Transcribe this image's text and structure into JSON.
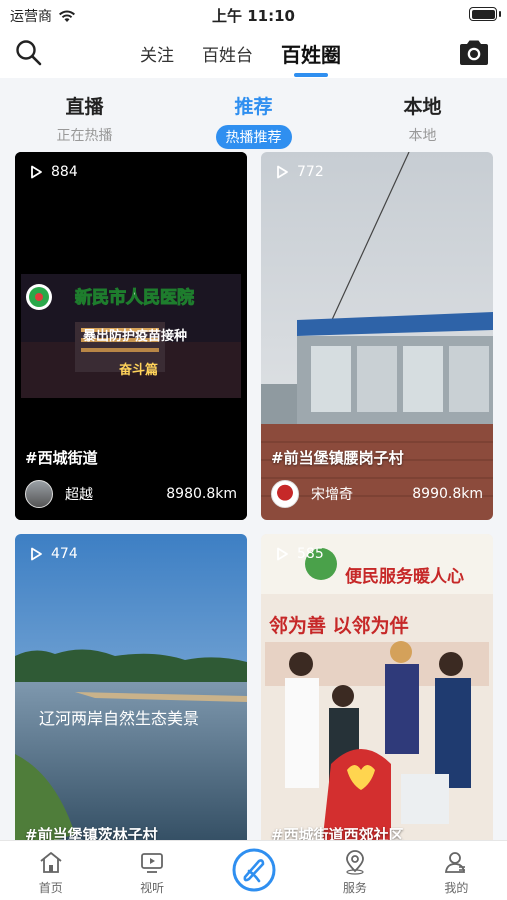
{
  "status_bar": {
    "carrier": "运营商",
    "time": "上午 11:10"
  },
  "top_nav": {
    "tabs": [
      {
        "label": "关注"
      },
      {
        "label": "百姓台"
      },
      {
        "label": "百姓圈",
        "active": true
      }
    ],
    "icons": {
      "search": "search-icon",
      "camera": "camera-icon"
    }
  },
  "sub_tabs": [
    {
      "title": "直播",
      "desc": "正在热播"
    },
    {
      "title": "推荐",
      "desc": "热播推荐",
      "active": true
    },
    {
      "title": "本地",
      "desc": "本地"
    }
  ],
  "cards": [
    {
      "plays": "884",
      "title": "#西城街道",
      "author": "超越",
      "distance": "8980.8km"
    },
    {
      "plays": "772",
      "title": "#前当堡镇腰岗子村",
      "author": "宋增奇",
      "distance": "8990.8km"
    },
    {
      "plays": "474",
      "title": "#前当堡镇茨林子村",
      "overlay_text": "辽河两岸自然生态美景"
    },
    {
      "plays": "585",
      "title": "#西城街道西郊社区",
      "sign_top": "便民服务暖人心",
      "sign_mid": "邻为善  以邻为伴"
    }
  ],
  "card1_overlay": {
    "line1": "新民市人民医院",
    "line2": "暴出防护疫苗接种",
    "line3": "奋斗篇"
  },
  "bottom_bar": [
    {
      "label": "首页",
      "icon": "home-icon"
    },
    {
      "label": "视听",
      "icon": "tv-icon"
    },
    {
      "label": "",
      "icon": "publish-icon"
    },
    {
      "label": "服务",
      "icon": "location-icon"
    },
    {
      "label": "我的",
      "icon": "user-icon"
    }
  ],
  "colors": {
    "accent": "#2f8ff0",
    "background": "#f3f5f8"
  }
}
